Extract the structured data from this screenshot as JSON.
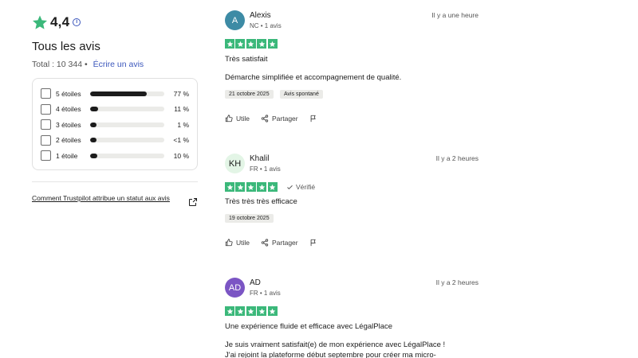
{
  "summary": {
    "rating": "4,4",
    "title": "Tous les avis",
    "total": "Total : 10 344",
    "write_link": "Écrire un avis",
    "info_icon": "info-icon",
    "star_color": "#3bb87a",
    "link_color": "#3c57bc"
  },
  "distribution": [
    {
      "label": "5 étoiles",
      "percent": "77 %",
      "fill": 0.77
    },
    {
      "label": "4 étoiles",
      "percent": "11 %",
      "fill": 0.11
    },
    {
      "label": "3 étoiles",
      "percent": "1 %",
      "fill": 0.01
    },
    {
      "label": "2 étoiles",
      "percent": "<1 %",
      "fill": 0.005
    },
    {
      "label": "1 étoile",
      "percent": "10 %",
      "fill": 0.1
    }
  ],
  "trust_link": "Comment Trustpilot attribue un statut aux avis",
  "actions": {
    "useful": "Utile",
    "share": "Partager"
  },
  "reviews": [
    {
      "initials": "A",
      "avatar_bg": "#3d8ba5",
      "avatar_fg": "#ffffff",
      "name": "Alexis",
      "meta": "NC • 1 avis",
      "time": "Il y a une heure",
      "stars": 5,
      "verified": "",
      "title": "Très satisfait",
      "body": "Démarche simplifiée et accompagnement de qualité.",
      "date": "21 octobre 2025",
      "source": "Avis spontané"
    },
    {
      "initials": "KH",
      "avatar_bg": "#e3f5e6",
      "avatar_fg": "#1c1c1c",
      "name": "Khalil",
      "meta": "FR • 1 avis",
      "time": "Il y a 2 heures",
      "stars": 5,
      "verified": "Vérifié",
      "title": "Très très très efficace",
      "body": "",
      "date": "19 octobre 2025",
      "source": ""
    },
    {
      "initials": "AD",
      "avatar_bg": "#7b55c4",
      "avatar_fg": "#ffffff",
      "name": "AD",
      "meta": "FR • 1 avis",
      "time": "Il y a 2 heures",
      "stars": 5,
      "verified": "",
      "title": "Une expérience fluide et efficace avec LégalPlace",
      "body_lines": [
        "Je suis vraiment satisfait(e) de mon expérience avec LégalPlace !",
        "J'ai rejoint la plateforme début septembre pour créer ma micro-"
      ]
    }
  ]
}
